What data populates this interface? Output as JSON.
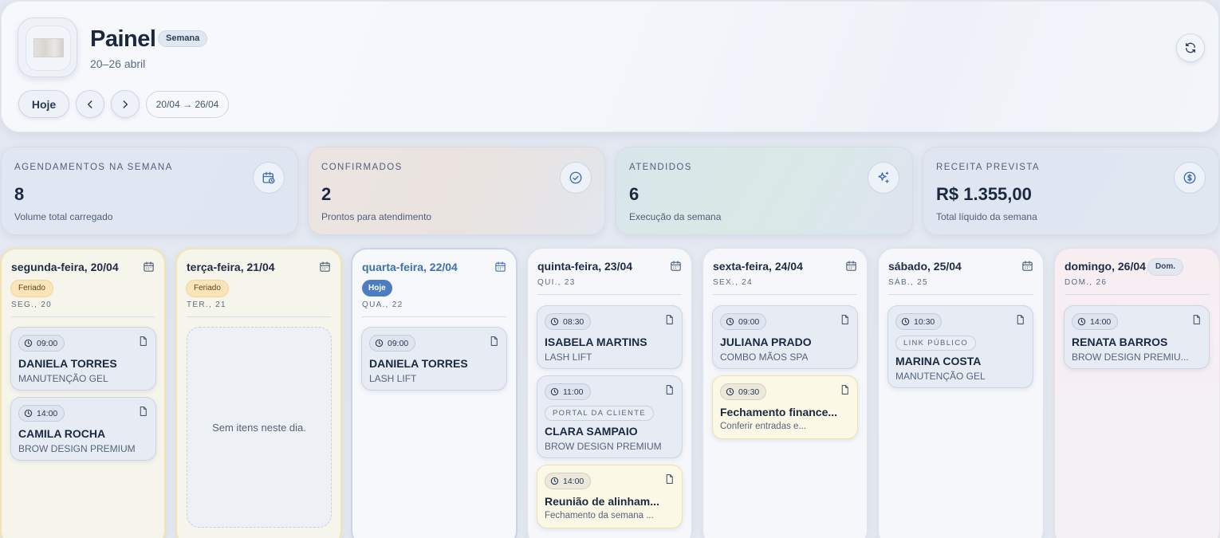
{
  "header": {
    "title": "Painel",
    "badge": "Semana",
    "date_range": "20–26 abril",
    "today_label": "Hoje",
    "range_label": "20/04 → 26/04"
  },
  "stats": [
    {
      "label": "AGENDAMENTOS NA SEMANA",
      "value": "8",
      "sub": "Volume total carregado",
      "icon": "calendar-clock-icon"
    },
    {
      "label": "CONFIRMADOS",
      "value": "2",
      "sub": "Prontos para atendimento",
      "icon": "check-circle-icon"
    },
    {
      "label": "ATENDIDOS",
      "value": "6",
      "sub": "Execução da semana",
      "icon": "sparkles-icon"
    },
    {
      "label": "RECEITA PREVISTA",
      "value": "R$ 1.355,00",
      "sub": "Total líquido da semana",
      "icon": "dollar-circle-icon"
    }
  ],
  "days": [
    {
      "title": "segunda-feira, 20/04",
      "abbr": "SEG., 20",
      "pill": "Feriado",
      "cards": [
        {
          "time": "09:00",
          "name": "DANIELA TORRES",
          "service": "MANUTENÇÃO GEL"
        },
        {
          "time": "14:00",
          "name": "CAMILA ROCHA",
          "service": "BROW DESIGN PREMIUM"
        }
      ]
    },
    {
      "title": "terça-feira, 21/04",
      "abbr": "TER., 21",
      "pill": "Feriado",
      "empty": "Sem itens neste dia."
    },
    {
      "title": "quarta-feira, 22/04",
      "abbr": "QUA., 22",
      "pill": "Hoje",
      "cards": [
        {
          "time": "09:00",
          "name": "DANIELA TORRES",
          "service": "LASH LIFT"
        }
      ]
    },
    {
      "title": "quinta-feira, 23/04",
      "abbr": "QUI., 23",
      "cards": [
        {
          "time": "08:30",
          "name": "ISABELA MARTINS",
          "service": "LASH LIFT"
        },
        {
          "time": "11:00",
          "source": "PORTAL DA CLIENTE",
          "name": "CLARA SAMPAIO",
          "service": "BROW DESIGN PREMIUM"
        },
        {
          "time": "14:00",
          "name": "Reunião de alinham...",
          "service": "Fechamento da semana ..."
        }
      ]
    },
    {
      "title": "sexta-feira, 24/04",
      "abbr": "SEX., 24",
      "cards": [
        {
          "time": "09:00",
          "name": "JULIANA PRADO",
          "service": "COMBO MÃOS SPA"
        },
        {
          "time": "09:30",
          "name": "Fechamento finance...",
          "service": "Conferir entradas e..."
        }
      ]
    },
    {
      "title": "sábado, 25/04",
      "abbr": "SÁB., 25",
      "cards": [
        {
          "time": "10:30",
          "source": "LINK PÚBLICO",
          "name": "MARINA COSTA",
          "service": "MANUTENÇÃO GEL"
        }
      ]
    },
    {
      "title": "domingo, 26/04",
      "abbr": "DOM., 26",
      "pill": "Dom.",
      "cards": [
        {
          "time": "14:00",
          "name": "RENATA BARROS",
          "service": "BROW DESIGN PREMIU..."
        }
      ]
    }
  ],
  "colors": {
    "accent": "#4d7cc3",
    "holiday_pill": "#fbe4b8",
    "task_card": "#fbf8e6",
    "text_dark": "#1b2940"
  }
}
